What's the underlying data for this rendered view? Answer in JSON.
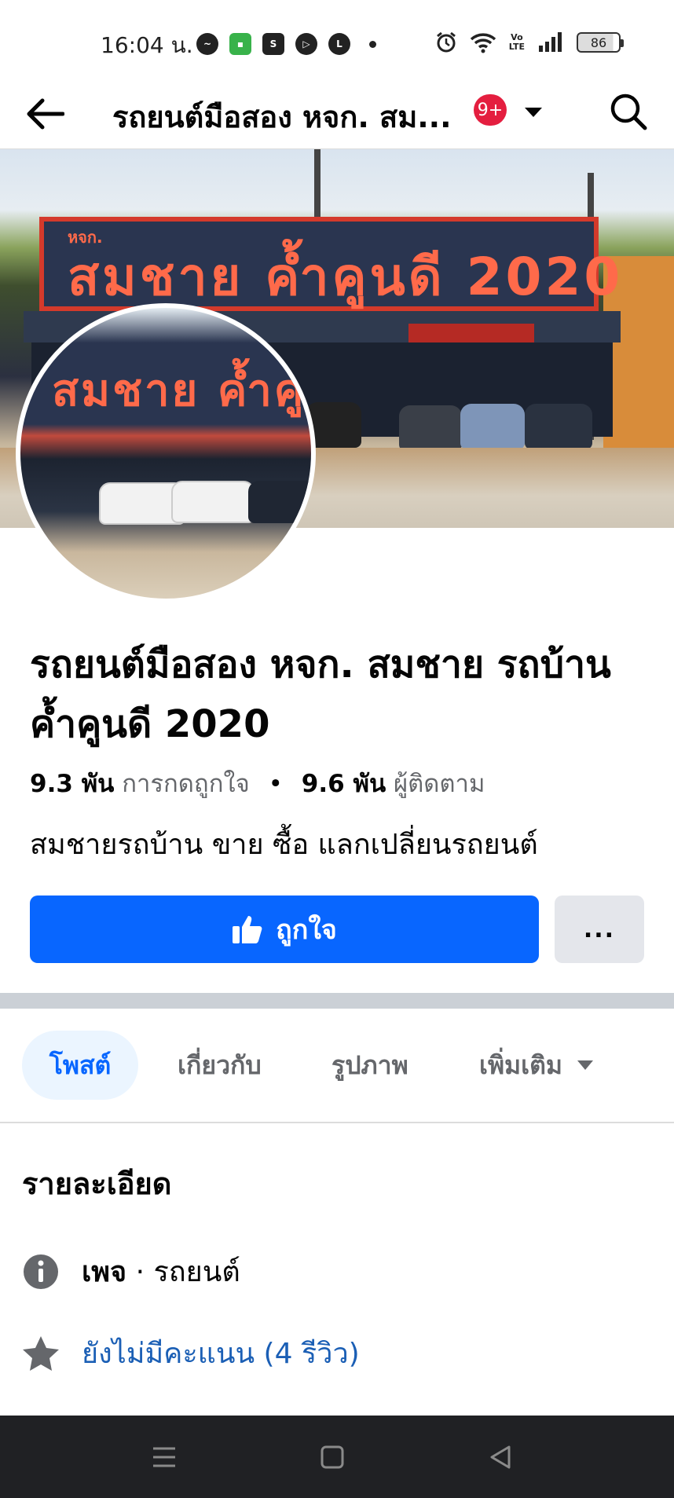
{
  "status_bar": {
    "time": "16:04 น.",
    "battery": "86",
    "volte": "Vo LTE"
  },
  "header": {
    "title": "รถยนต์มือสอง หจก. สม...",
    "badge": "9+"
  },
  "cover": {
    "sign_small": "หจก.",
    "sign_text": "สมชาย ค้ำคูนดี 2020",
    "profile_sign_text": "สมชาย ค้ำคูน"
  },
  "page": {
    "name": "รถยนต์มือสอง หจก. สมชาย รถบ้าน ค้ำคูนดี 2020",
    "likes_count": "9.3 พัน",
    "likes_label": "การกดถูกใจ",
    "separator": "•",
    "followers_count": "9.6 พัน",
    "followers_label": "ผู้ติดตาม",
    "description": "สมชายรถบ้าน ขาย ซื้อ แลกเปลี่ยนรถยนต์"
  },
  "actions": {
    "like_label": "ถูกใจ",
    "more_label": "..."
  },
  "tabs": [
    {
      "label": "โพสต์",
      "active": true
    },
    {
      "label": "เกี่ยวกับ",
      "active": false
    },
    {
      "label": "รูปภาพ",
      "active": false
    },
    {
      "label": "เพิ่มเติม",
      "active": false
    }
  ],
  "details": {
    "title": "รายละเอียด",
    "page_type_label": "เพจ",
    "page_type_sep": "·",
    "page_type_value": "รถยนต์",
    "rating_text": "ยังไม่มีคะแนน (4 รีวิว)"
  },
  "colors": {
    "brand_blue": "#0866ff",
    "badge_red": "#e41e3f",
    "link_blue": "#1b5fb5",
    "tab_active_bg": "#ebf5ff"
  },
  "icons": [
    "back-arrow-icon",
    "caret-down-icon",
    "search-icon",
    "thumbs-up-icon",
    "info-icon",
    "star-icon",
    "menu-icon",
    "home-icon",
    "back-triangle-icon"
  ]
}
